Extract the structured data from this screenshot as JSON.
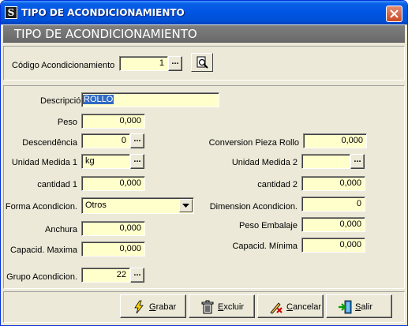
{
  "window": {
    "title": "TIPO DE ACONDICIONAMIENTO"
  },
  "header": {
    "title": "TIPO DE ACONDICIONAMIENTO"
  },
  "code": {
    "label": "Código Acondicionamiento",
    "value": "1",
    "browse": "..."
  },
  "form": {
    "descripcion": {
      "label": "Descripción",
      "value": "ROLLO"
    },
    "peso": {
      "label": "Peso",
      "value": "0,000"
    },
    "descendencia": {
      "label": "Descendência",
      "value": "0",
      "browse": "..."
    },
    "unidad1": {
      "label": "Unidad Medida 1",
      "value": "kg",
      "browse": "..."
    },
    "cantidad1": {
      "label": "cantidad  1",
      "value": "0,000"
    },
    "forma": {
      "label": "Forma Acondicion.",
      "value": "Otros"
    },
    "anchura": {
      "label": "Anchura",
      "value": "0,000"
    },
    "capmax": {
      "label": "Capacid. Maxima",
      "value": "0,000"
    },
    "grupo": {
      "label": "Grupo Acondicion.",
      "value": "22",
      "browse": "..."
    },
    "conversion": {
      "label": "Conversion Pieza Rollo",
      "value": "0,000"
    },
    "unidad2": {
      "label": "Unidad Medida 2",
      "value": "",
      "browse": "..."
    },
    "cantidad2": {
      "label": "cantidad  2",
      "value": "0,000"
    },
    "dimension": {
      "label": "Dimension Acondicion.",
      "value": "0"
    },
    "pesoemb": {
      "label": "Peso Embalaje",
      "value": "0,000"
    },
    "capmin": {
      "label": "Capacid. Mínima",
      "value": "0,000"
    }
  },
  "buttons": {
    "grabar": {
      "key": "G",
      "rest": "rabar"
    },
    "excluir": {
      "key": "E",
      "rest": "xcluir"
    },
    "cancelar": {
      "key": "C",
      "rest": "ancelar"
    },
    "salir": {
      "key": "S",
      "rest": "alir"
    }
  },
  "colors": {
    "field_bg": "#ffffcc",
    "title_blue": "#0054e3",
    "header_gray": "#707070",
    "selection": "#316ac5"
  }
}
